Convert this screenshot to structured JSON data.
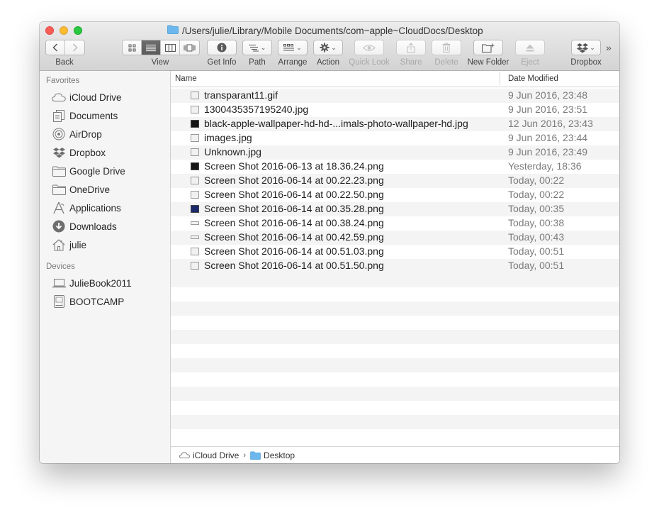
{
  "window": {
    "title": "/Users/julie/Library/Mobile Documents/com~apple~CloudDocs/Desktop"
  },
  "toolbar": {
    "back_label": "Back",
    "view_label": "View",
    "get_info_label": "Get Info",
    "path_label": "Path",
    "arrange_label": "Arrange",
    "action_label": "Action",
    "quick_look_label": "Quick Look",
    "share_label": "Share",
    "delete_label": "Delete",
    "new_folder_label": "New Folder",
    "eject_label": "Eject",
    "dropbox_label": "Dropbox",
    "overflow_label": "»"
  },
  "sidebar": {
    "favorites_header": "Favorites",
    "favorites": [
      {
        "label": "iCloud Drive",
        "icon": "cloud-icon"
      },
      {
        "label": "Documents",
        "icon": "documents-icon"
      },
      {
        "label": "AirDrop",
        "icon": "airdrop-icon"
      },
      {
        "label": "Dropbox",
        "icon": "dropbox-icon"
      },
      {
        "label": "Google Drive",
        "icon": "folder-icon"
      },
      {
        "label": "OneDrive",
        "icon": "folder-icon"
      },
      {
        "label": "Applications",
        "icon": "applications-icon"
      },
      {
        "label": "Downloads",
        "icon": "downloads-icon"
      },
      {
        "label": "julie",
        "icon": "home-icon"
      }
    ],
    "devices_header": "Devices",
    "devices": [
      {
        "label": "JulieBook2011",
        "icon": "laptop-icon"
      },
      {
        "label": "BOOTCAMP",
        "icon": "disk-icon"
      }
    ]
  },
  "columns": {
    "name": "Name",
    "date_modified": "Date Modified"
  },
  "files": [
    {
      "name": "transparant11.gif",
      "date": "9 Jun 2016, 23:48",
      "thumb": "light"
    },
    {
      "name": "1300435357195240.jpg",
      "date": "9 Jun 2016, 23:51",
      "thumb": "light"
    },
    {
      "name": "black-apple-wallpaper-hd-hd-...imals-photo-wallpaper-hd.jpg",
      "date": "12 Jun 2016, 23:43",
      "thumb": "dark"
    },
    {
      "name": "images.jpg",
      "date": "9 Jun 2016, 23:44",
      "thumb": "light"
    },
    {
      "name": "Unknown.jpg",
      "date": "9 Jun 2016, 23:49",
      "thumb": "light"
    },
    {
      "name": "Screen Shot 2016-06-13 at 18.36.24.png",
      "date": "Yesterday, 18:36",
      "thumb": "dark"
    },
    {
      "name": "Screen Shot 2016-06-14 at 00.22.23.png",
      "date": "Today, 00:22",
      "thumb": "light"
    },
    {
      "name": "Screen Shot 2016-06-14 at 00.22.50.png",
      "date": "Today, 00:22",
      "thumb": "light"
    },
    {
      "name": "Screen Shot 2016-06-14 at 00.35.28.png",
      "date": "Today, 00:35",
      "thumb": "dark"
    },
    {
      "name": "Screen Shot 2016-06-14 at 00.38.24.png",
      "date": "Today, 00:38",
      "thumb": "flat"
    },
    {
      "name": "Screen Shot 2016-06-14 at 00.42.59.png",
      "date": "Today, 00:43",
      "thumb": "flat"
    },
    {
      "name": "Screen Shot 2016-06-14 at 00.51.03.png",
      "date": "Today, 00:51",
      "thumb": "light"
    },
    {
      "name": "Screen Shot 2016-06-14 at 00.51.50.png",
      "date": "Today, 00:51",
      "thumb": "light"
    }
  ],
  "pathbar": [
    {
      "label": "iCloud Drive",
      "icon": "cloud-icon"
    },
    {
      "label": "Desktop",
      "icon": "folder-icon"
    }
  ],
  "colors": {
    "close": "#fd5f57",
    "minimize": "#fdbc2e",
    "maximize": "#29c840",
    "folder_blue": "#6cb8ee"
  }
}
